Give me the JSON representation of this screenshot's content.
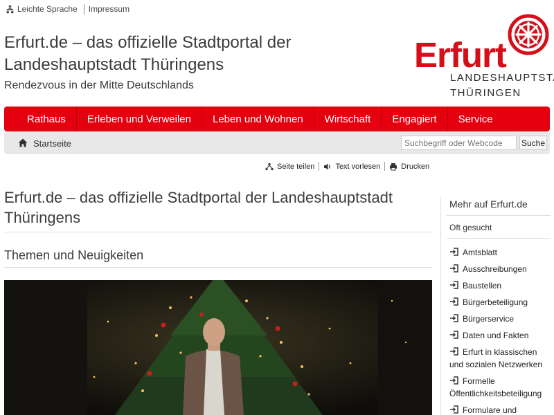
{
  "top_links": [
    {
      "label": "Leichte Sprache",
      "icon": "easy-language-icon"
    },
    {
      "label": "Impressum"
    }
  ],
  "site": {
    "title": "Erfurt.de – das offizielle Stadtportal der Landeshauptstadt Thüringens",
    "subtitle": "Rendezvous in der Mitte Deutschlands"
  },
  "logo": {
    "word": "Erfurt",
    "line1": "LANDESHAUPTSTADT",
    "line2": "THÜRINGEN",
    "color": "#d40f19",
    "icon": "erfurt-wheel-icon"
  },
  "nav": {
    "color": "#e4000f",
    "items": [
      "Rathaus",
      "Erleben und Verweilen",
      "Leben und Wohnen",
      "Wirtschaft",
      "Engagiert",
      "Service"
    ]
  },
  "breadcrumb": {
    "home_icon": "home-icon",
    "current": "Startseite"
  },
  "search": {
    "placeholder": "Suchbegriff oder Webcode",
    "button_label": "Suche"
  },
  "tools": [
    {
      "label": "Seite teilen",
      "icon": "share-icon"
    },
    {
      "label": "Text vorlesen",
      "icon": "speaker-icon"
    },
    {
      "label": "Drucken",
      "icon": "print-icon"
    }
  ],
  "main": {
    "heading": "Erfurt.de – das offizielle Stadtportal der Landeshauptstadt Thüringens",
    "section_heading": "Themen und Neuigkeiten",
    "hero_image": "man-in-front-of-christmas-tree-photo"
  },
  "sidebar": {
    "title": "Mehr auf Erfurt.de",
    "subtitle": "Oft gesucht",
    "link_icon": "enter-arrow-icon",
    "items": [
      "Amtsblatt",
      "Ausschreibungen",
      "Baustellen",
      "Bürgerbeteiligung",
      "Bürgerservice",
      "Daten und Fakten",
      "Erfurt in klassischen und sozialen Netzwerken",
      "Formelle Öffentlichkeitsbeteiligung",
      "Formulare und"
    ]
  }
}
